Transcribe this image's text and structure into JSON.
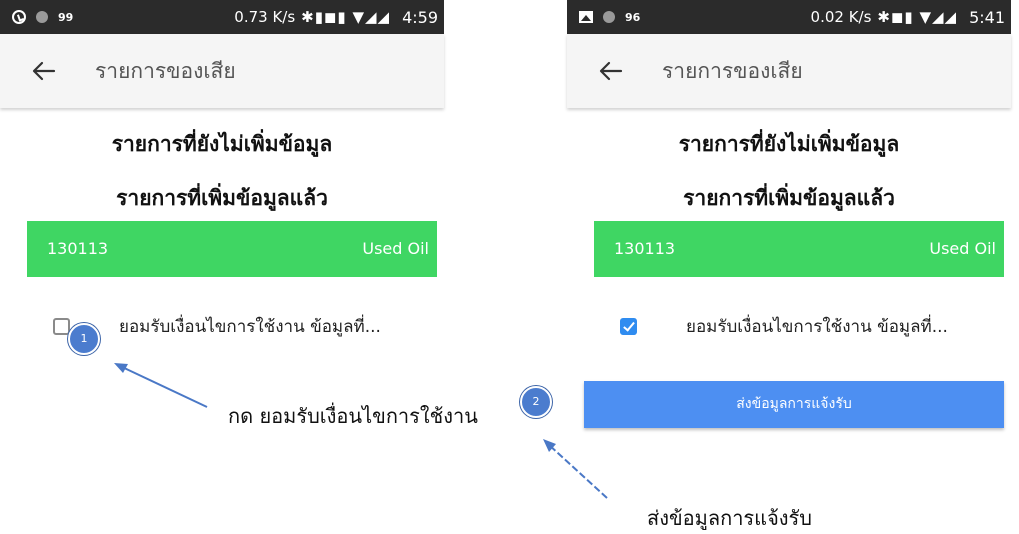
{
  "screens": {
    "left": {
      "status_bar": {
        "badge": "99",
        "speed": "0.73 K/s",
        "icons": "✱▮◼▮ ▼◢◢",
        "time": "4:59"
      },
      "app_bar": {
        "title": "รายการของเสีย"
      },
      "tab_pending": "รายการที่ยังไม่เพิ่มข้อมูล",
      "tab_done": "รายการที่เพิ่มข้อมูลแล้ว",
      "item": {
        "code": "130113",
        "type": "Used Oil"
      },
      "terms": {
        "label": "ยอมรับเงื่อนไขการใช้งาน ข้อมูลที่...",
        "checked": false
      }
    },
    "right": {
      "status_bar": {
        "badge": "96",
        "speed": "0.02 K/s",
        "icons": "✱◼▮ ▼◢◢",
        "time": "5:41"
      },
      "app_bar": {
        "title": "รายการของเสีย"
      },
      "tab_pending": "รายการที่ยังไม่เพิ่มข้อมูล",
      "tab_done": "รายการที่เพิ่มข้อมูลแล้ว",
      "item": {
        "code": "130113",
        "type": "Used Oil"
      },
      "terms": {
        "label": "ยอมรับเงื่อนไขการใช้งาน ข้อมูลที่...",
        "checked": true
      },
      "submit_label": "ส่งข้อมูลการแจ้งรับ"
    }
  },
  "annotations": {
    "step1": {
      "number": "1",
      "text": "กด ยอมรับเงื่อนไขการใช้งาน"
    },
    "step2": {
      "number": "2",
      "text": "ส่งข้อมูลการแจ้งรับ"
    }
  },
  "colors": {
    "item_bar": "#3fd663",
    "submit_button": "#4d8ff2",
    "checkbox_checked": "#2f8cf0",
    "badge": "#4b7cce",
    "arrow": "#4a78c6"
  },
  "icons": [
    "back-arrow-icon",
    "clock-icon",
    "photo-icon",
    "arrow-icon"
  ]
}
